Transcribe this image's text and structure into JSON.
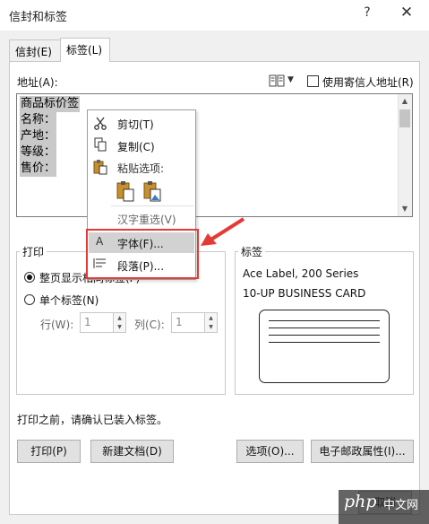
{
  "window": {
    "title": "信封和标签",
    "help": "?",
    "close": "✕"
  },
  "tabs": [
    {
      "label": "信封(E)"
    },
    {
      "label": "标签(L)"
    }
  ],
  "address": {
    "label": "地址(A):",
    "use_return_address_label": "使用寄信人地址(R)",
    "use_return_address_checked": false,
    "lines": [
      "商品标价签",
      "名称：",
      "产地：",
      "等级：",
      "售价："
    ]
  },
  "print_group": {
    "title": "打印",
    "full_page_label": "整页显示相同标签(F)",
    "single_label": "单个标签(N)",
    "selected": "full_page",
    "row_label": "行(W):",
    "row_value": "1",
    "col_label": "列(C):",
    "col_value": "1"
  },
  "label_group": {
    "title": "标签",
    "line1": "Ace Label, 200 Series",
    "line2": "10-UP BUSINESS CARD"
  },
  "footer_note": "打印之前，请确认已装入标签。",
  "buttons": {
    "print": "打印(P)",
    "new_document": "新建文档(D)",
    "options": "选项(O)...",
    "epostage": "电子邮政属性(I)...",
    "cancel": "取消"
  },
  "context_menu": {
    "cut": "剪切(T)",
    "copy": "复制(C)",
    "paste_options": "粘贴选项:",
    "reconvert": "汉字重选(V)",
    "font": "字体(F)...",
    "paragraph": "段落(P)..."
  },
  "watermark": {
    "logo": "php",
    "text": "中文网"
  },
  "colors": {
    "highlight_box": "#e53935",
    "menu_hover": "#d2d2d2",
    "text_selection": "#c9c9c9"
  }
}
